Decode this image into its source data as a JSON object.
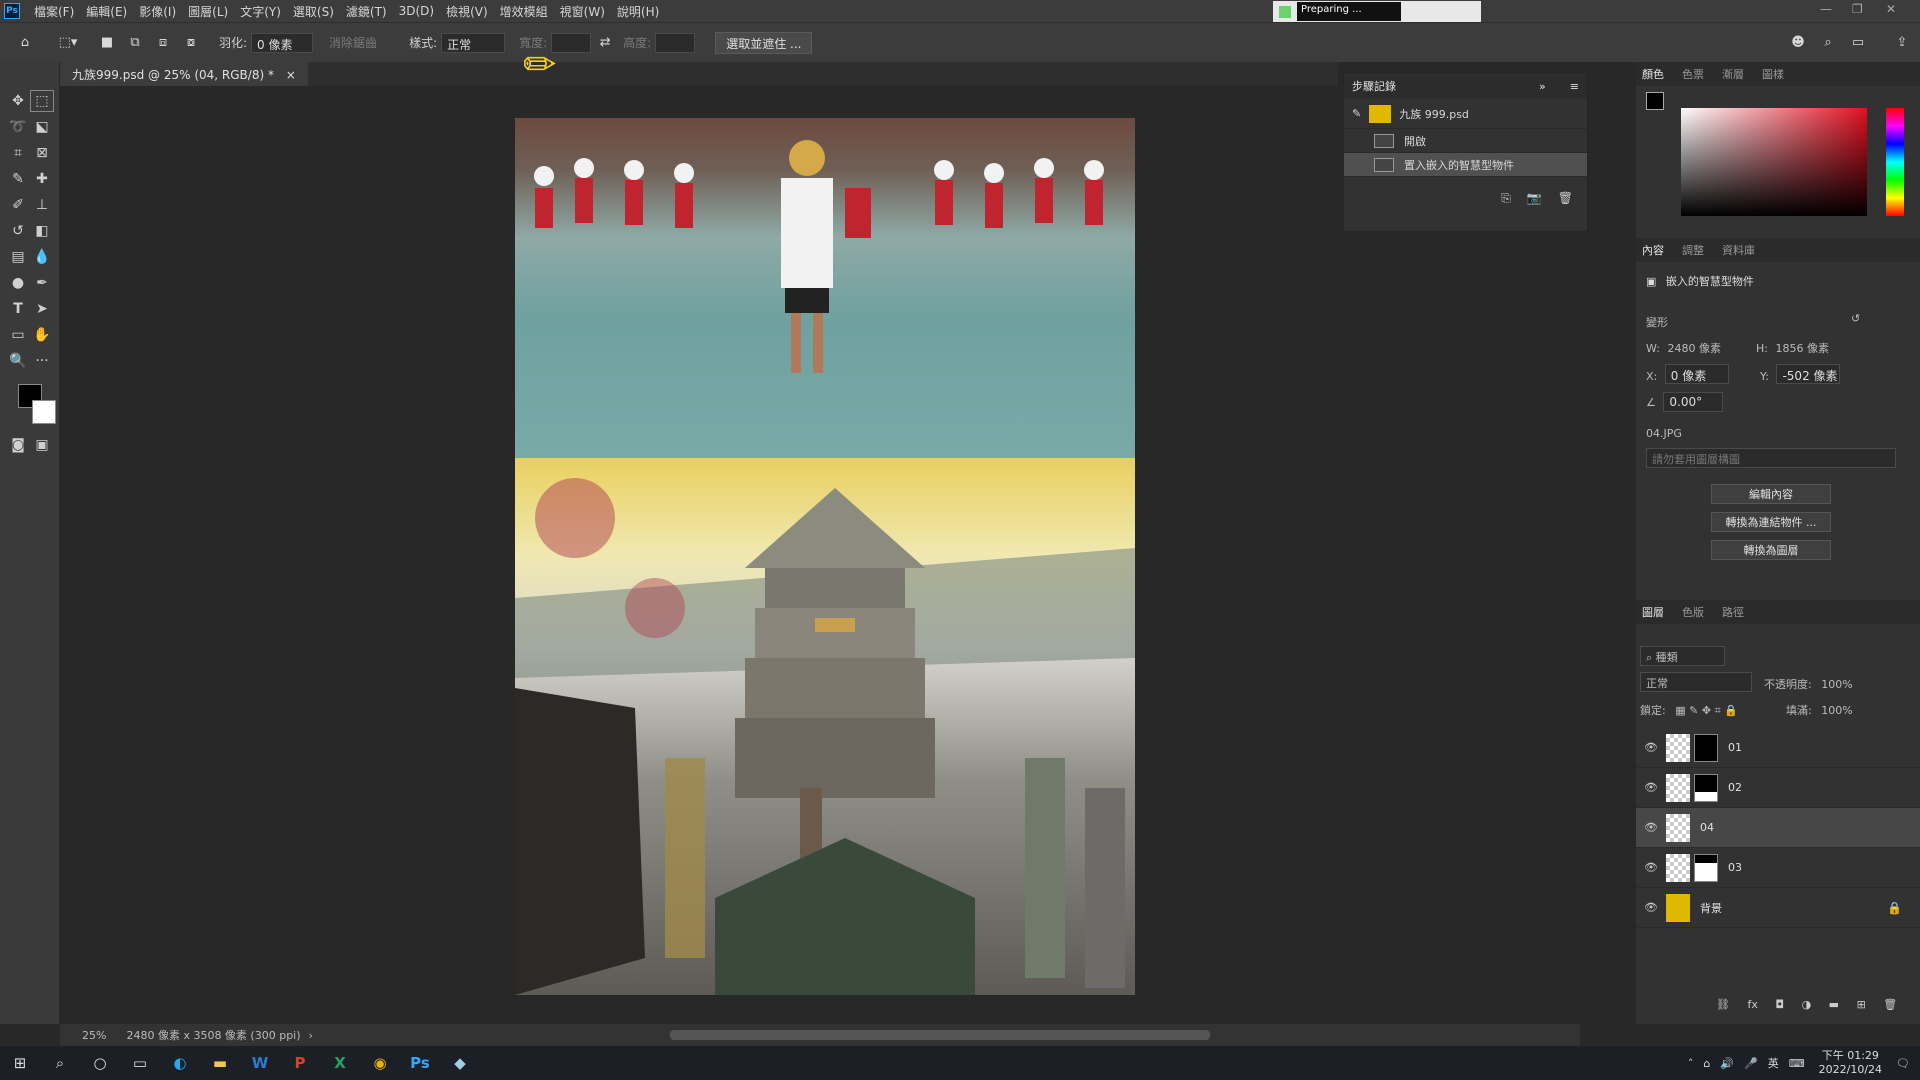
{
  "menubar": {
    "items": [
      "檔案(F)",
      "編輯(E)",
      "影像(I)",
      "圖層(L)",
      "文字(Y)",
      "選取(S)",
      "濾鏡(T)",
      "3D(D)",
      "檢視(V)",
      "增效模組",
      "視窗(W)",
      "說明(H)"
    ],
    "preparing": "Preparing ..."
  },
  "options": {
    "feather_label": "羽化:",
    "feather_value": "0 像素",
    "antialias_label": "消除鋸齒",
    "style_label": "樣式:",
    "style_value": "正常",
    "width_label": "寬度:",
    "height_label": "高度:",
    "select_mask_button": "選取並遮住 ..."
  },
  "doc_tab": {
    "title": "九族999.psd @ 25% (04, RGB/8) *",
    "close": "×"
  },
  "history": {
    "title": "步驟記錄",
    "snapshot": "九族 999.psd",
    "rows": [
      "開啟",
      "置入嵌入的智慧型物件"
    ]
  },
  "color_tabs": [
    "顏色",
    "色票",
    "漸層",
    "圖樣"
  ],
  "props_tabs": [
    "內容",
    "調整",
    "資料庫"
  ],
  "properties": {
    "object_type": "嵌入的智慧型物件",
    "transform_label": "變形",
    "w_label": "W:",
    "w_value": "2480 像素",
    "h_label": "H:",
    "h_value": "1856 像素",
    "x_label": "X:",
    "x_value": "0 像素",
    "y_label": "Y:",
    "y_value": "-502 像素",
    "angle_value": "0.00°",
    "filename": "04.JPG",
    "comp_placeholder": "請勿套用圖層構圖",
    "edit_contents": "編輯內容",
    "convert_linked": "轉換為連結物件 ...",
    "convert_layers": "轉換為圖層"
  },
  "layers_tabs": [
    "圖層",
    "色版",
    "路徑"
  ],
  "layers": {
    "filter_kind": "種類",
    "blend_mode": "正常",
    "opacity_label": "不透明度:",
    "opacity_value": "100%",
    "lock_label": "鎖定:",
    "fill_label": "填滿:",
    "fill_value": "100%",
    "items": [
      {
        "name": "01"
      },
      {
        "name": "02"
      },
      {
        "name": "04"
      },
      {
        "name": "03"
      },
      {
        "name": "背景"
      }
    ]
  },
  "status": {
    "zoom": "25%",
    "doc_size": "2480 像素 x 3508 像素 (300 ppi)"
  },
  "taskbar": {
    "time": "下午 01:29",
    "date": "2022/10/24",
    "ime": "英"
  },
  "colors": {
    "accent": "#31a8ff",
    "background_layer": "#e0b800"
  }
}
